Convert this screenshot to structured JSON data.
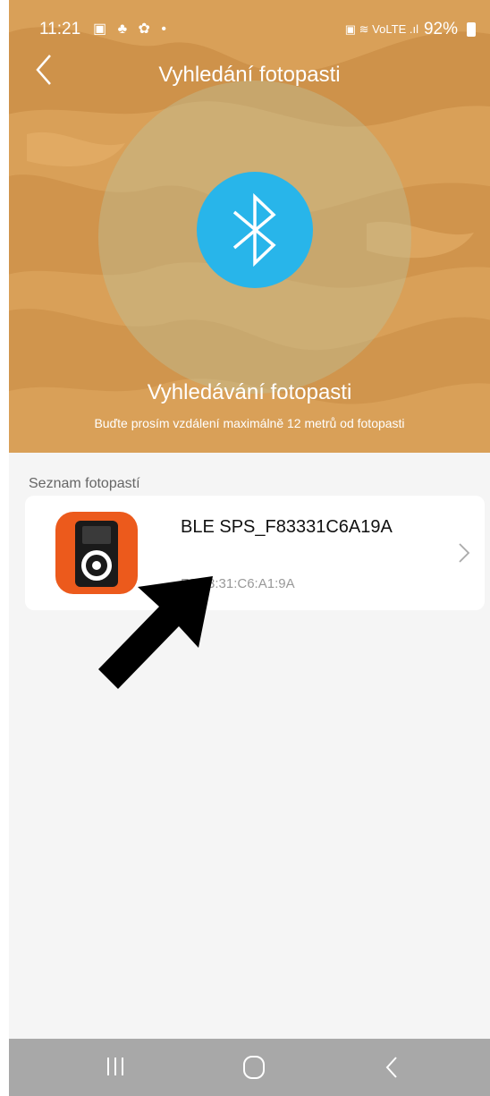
{
  "status_bar": {
    "time": "11:21",
    "left_icons": "▣ ♣ ✿ •",
    "right_icons": "▣ ≋ VoLTE .ıl",
    "battery": "92%"
  },
  "header": {
    "title": "Vyhledání fotopasti"
  },
  "scan": {
    "heading": "Vyhledávání fotopasti",
    "hint": "Buďte prosím vzdálení maximálně 12 metrů od fotopasti"
  },
  "list": {
    "section_title": "Seznam fotopastí",
    "devices": [
      {
        "name": "BLE SPS_F83331C6A19A",
        "mac": "F8:33:31:C6:A1:9A"
      }
    ]
  },
  "colors": {
    "hero_bg": "#d9a058",
    "bluetooth": "#28b5ea",
    "device_icon": "#ec5a1c",
    "navbar": "#a8a8a8"
  },
  "icons": [
    "back-icon",
    "bluetooth-icon",
    "camera-trap-icon",
    "chevron-right-icon",
    "recent-apps-icon",
    "home-icon",
    "nav-back-icon"
  ]
}
